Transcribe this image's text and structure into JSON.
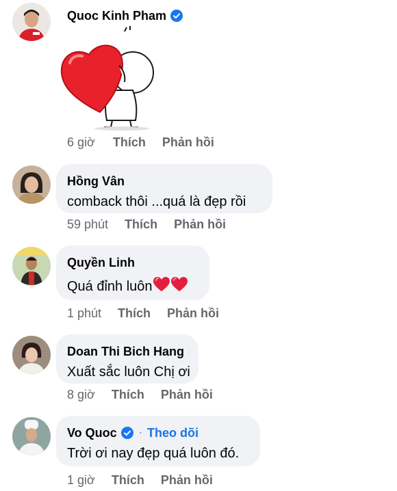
{
  "comments": [
    {
      "name": "Quoc Kinh Pham",
      "verified": true,
      "time": "6 giờ",
      "like": "Thích",
      "reply": "Phản hồi",
      "sticker": "heart-hug-sticker"
    },
    {
      "name": "Hồng Vân",
      "text": "comback thôi ...quá là đẹp rồi",
      "time": "59 phút",
      "like": "Thích",
      "reply": "Phản hồi"
    },
    {
      "name": "Quyền Linh",
      "text": "Quá đỉnh luôn",
      "emoji": [
        "red-heart",
        "red-heart"
      ],
      "time": "1 phút",
      "like": "Thích",
      "reply": "Phản hồi"
    },
    {
      "name": "Doan Thi Bich Hang",
      "text": "Xuất sắc luôn Chị ơi",
      "time": "8 giờ",
      "like": "Thích",
      "reply": "Phản hồi"
    },
    {
      "name": "Vo Quoc",
      "verified": true,
      "follow": "Theo dõi",
      "separator": "·",
      "text": "Trời ơi nay đẹp quá luôn đó.",
      "time": "1 giờ",
      "like": "Thích",
      "reply": "Phản hồi"
    }
  ],
  "colors": {
    "bubble": "#f0f2f5",
    "meta": "#65676b",
    "link": "#1b74e4",
    "verified": "#1877f2",
    "heart": "#e41e3f"
  }
}
